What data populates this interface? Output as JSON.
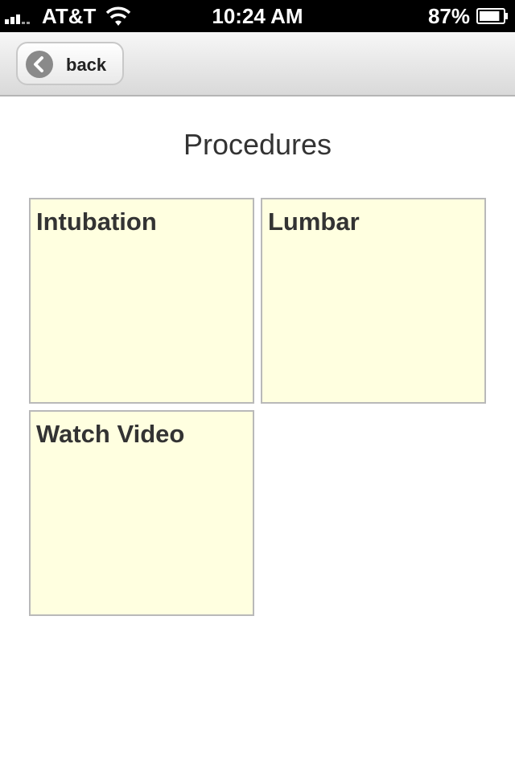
{
  "status_bar": {
    "carrier": "AT&T",
    "time": "10:24 AM",
    "battery_percent": "87%",
    "battery_level": 0.87,
    "icons": [
      "signal-strength-icon",
      "wifi-icon",
      "battery-icon"
    ]
  },
  "nav": {
    "back_label": "back",
    "back_icon": "chevron-left-circle-icon"
  },
  "page": {
    "title": "Procedures"
  },
  "tiles": [
    {
      "label": "Intubation"
    },
    {
      "label": "Lumbar"
    },
    {
      "label": "Watch Video"
    }
  ],
  "colors": {
    "tile_background": "#ffffe0",
    "tile_border": "#b9b9b9",
    "status_bar": "#000000",
    "nav_bar_top": "#f7f7f7",
    "nav_bar_bottom": "#d9d9d9"
  }
}
